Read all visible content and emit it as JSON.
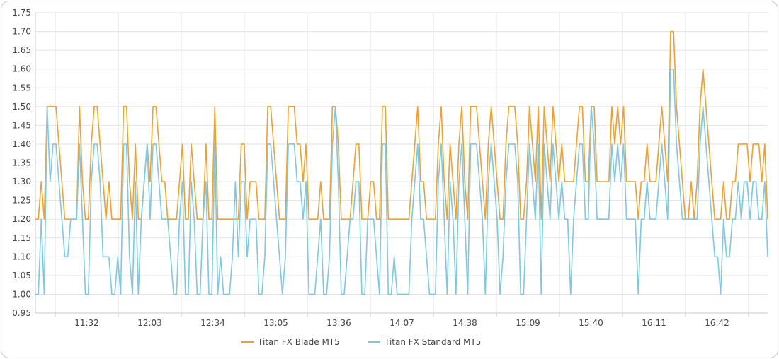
{
  "colors": {
    "blade": "#f0a030",
    "standard": "#7ec8e3",
    "grid": "#e3e3e3",
    "axis": "#c8c8c8"
  },
  "chart_data": {
    "type": "line",
    "title": "",
    "xlabel": "",
    "ylabel": "",
    "ylim": [
      0.95,
      1.75
    ],
    "yticks": [
      "0.95",
      "1.00",
      "1.05",
      "1.10",
      "1.15",
      "1.20",
      "1.25",
      "1.30",
      "1.35",
      "1.40",
      "1.45",
      "1.50",
      "1.55",
      "1.60",
      "1.65",
      "1.70",
      "1.75"
    ],
    "xticks": [
      "11:32",
      "12:03",
      "12:34",
      "13:05",
      "13:36",
      "14:07",
      "14:38",
      "15:09",
      "15:40",
      "16:11",
      "16:42"
    ],
    "legend_position": "bottom",
    "x_points": 230,
    "series": [
      {
        "name": "Titan FX Blade MT5",
        "color": "#f0a030",
        "values": [
          1.2,
          1.2,
          1.3,
          1.2,
          1.5,
          1.5,
          1.5,
          1.5,
          1.4,
          1.3,
          1.2,
          1.2,
          1.2,
          1.2,
          1.2,
          1.5,
          1.3,
          1.2,
          1.2,
          1.4,
          1.5,
          1.5,
          1.4,
          1.3,
          1.2,
          1.3,
          1.2,
          1.2,
          1.2,
          1.2,
          1.5,
          1.5,
          1.3,
          1.2,
          1.4,
          1.2,
          1.2,
          1.3,
          1.4,
          1.3,
          1.5,
          1.5,
          1.4,
          1.3,
          1.3,
          1.2,
          1.2,
          1.2,
          1.2,
          1.3,
          1.4,
          1.2,
          1.2,
          1.4,
          1.3,
          1.2,
          1.2,
          1.2,
          1.4,
          1.2,
          1.2,
          1.5,
          1.2,
          1.2,
          1.2,
          1.2,
          1.2,
          1.2,
          1.2,
          1.2,
          1.4,
          1.4,
          1.2,
          1.3,
          1.3,
          1.3,
          1.2,
          1.2,
          1.2,
          1.5,
          1.5,
          1.4,
          1.3,
          1.2,
          1.2,
          1.2,
          1.5,
          1.5,
          1.5,
          1.4,
          1.4,
          1.3,
          1.4,
          1.2,
          1.2,
          1.2,
          1.2,
          1.3,
          1.2,
          1.2,
          1.2,
          1.5,
          1.5,
          1.4,
          1.2,
          1.2,
          1.2,
          1.2,
          1.3,
          1.4,
          1.4,
          1.2,
          1.2,
          1.2,
          1.3,
          1.3,
          1.2,
          1.2,
          1.5,
          1.5,
          1.2,
          1.2,
          1.2,
          1.2,
          1.2,
          1.2,
          1.2,
          1.2,
          1.3,
          1.4,
          1.5,
          1.3,
          1.3,
          1.2,
          1.2,
          1.2,
          1.2,
          1.4,
          1.5,
          1.3,
          1.2,
          1.4,
          1.3,
          1.2,
          1.4,
          1.5,
          1.3,
          1.2,
          1.5,
          1.5,
          1.5,
          1.4,
          1.3,
          1.2,
          1.4,
          1.5,
          1.4,
          1.3,
          1.2,
          1.2,
          1.4,
          1.5,
          1.5,
          1.5,
          1.4,
          1.2,
          1.2,
          1.3,
          1.5,
          1.4,
          1.3,
          1.5,
          1.2,
          1.5,
          1.4,
          1.3,
          1.5,
          1.4,
          1.3,
          1.4,
          1.3,
          1.3,
          1.3,
          1.3,
          1.4,
          1.5,
          1.5,
          1.3,
          1.3,
          1.5,
          1.5,
          1.3,
          1.3,
          1.3,
          1.3,
          1.3,
          1.5,
          1.4,
          1.5,
          1.4,
          1.5,
          1.3,
          1.3,
          1.3,
          1.3,
          1.2,
          1.3,
          1.3,
          1.4,
          1.3,
          1.3,
          1.3,
          1.4,
          1.5,
          1.4,
          1.3,
          1.7,
          1.7,
          1.5,
          1.4,
          1.3,
          1.2,
          1.2,
          1.3,
          1.2,
          1.3,
          1.5,
          1.6,
          1.5,
          1.4,
          1.3,
          1.2,
          1.2,
          1.2,
          1.3,
          1.2,
          1.2,
          1.3,
          1.3,
          1.4,
          1.4,
          1.4,
          1.4,
          1.3,
          1.4,
          1.4,
          1.4,
          1.3,
          1.4,
          1.2
        ]
      },
      {
        "name": "Titan FX Standard MT5",
        "color": "#7ec8e3",
        "values": [
          1.0,
          1.0,
          1.2,
          1.0,
          1.5,
          1.3,
          1.4,
          1.4,
          1.3,
          1.2,
          1.1,
          1.1,
          1.2,
          1.2,
          1.2,
          1.4,
          1.2,
          1.0,
          1.0,
          1.3,
          1.4,
          1.4,
          1.3,
          1.1,
          1.1,
          1.1,
          1.0,
          1.0,
          1.1,
          1.0,
          1.4,
          1.4,
          1.1,
          1.0,
          1.3,
          1.0,
          1.2,
          1.3,
          1.4,
          1.2,
          1.4,
          1.4,
          1.3,
          1.2,
          1.2,
          1.2,
          1.1,
          1.0,
          1.0,
          1.2,
          1.3,
          1.0,
          1.0,
          1.3,
          1.2,
          1.0,
          1.0,
          1.2,
          1.3,
          1.0,
          1.0,
          1.4,
          1.0,
          1.1,
          1.0,
          1.0,
          1.0,
          1.1,
          1.3,
          1.1,
          1.3,
          1.3,
          1.1,
          1.2,
          1.2,
          1.2,
          1.0,
          1.0,
          1.1,
          1.4,
          1.4,
          1.3,
          1.2,
          1.1,
          1.0,
          1.1,
          1.4,
          1.4,
          1.4,
          1.3,
          1.3,
          1.2,
          1.3,
          1.0,
          1.0,
          1.0,
          1.1,
          1.2,
          1.0,
          1.0,
          1.1,
          1.4,
          1.5,
          1.3,
          1.0,
          1.0,
          1.1,
          1.2,
          1.2,
          1.3,
          1.3,
          1.0,
          1.0,
          1.2,
          1.2,
          1.2,
          1.1,
          1.0,
          1.4,
          1.4,
          1.0,
          1.0,
          1.1,
          1.0,
          1.0,
          1.0,
          1.0,
          1.0,
          1.2,
          1.3,
          1.4,
          1.2,
          1.2,
          1.1,
          1.0,
          1.0,
          1.0,
          1.3,
          1.4,
          1.2,
          1.0,
          1.3,
          1.2,
          1.0,
          1.3,
          1.4,
          1.2,
          1.0,
          1.4,
          1.4,
          1.4,
          1.3,
          1.2,
          1.0,
          1.3,
          1.4,
          1.3,
          1.2,
          1.0,
          1.1,
          1.3,
          1.4,
          1.4,
          1.4,
          1.3,
          1.0,
          1.0,
          1.2,
          1.4,
          1.3,
          1.2,
          1.4,
          1.0,
          1.4,
          1.3,
          1.2,
          1.4,
          1.3,
          1.2,
          1.3,
          1.2,
          1.2,
          1.0,
          1.2,
          1.3,
          1.4,
          1.4,
          1.2,
          1.2,
          1.5,
          1.4,
          1.2,
          1.2,
          1.2,
          1.2,
          1.2,
          1.4,
          1.3,
          1.4,
          1.3,
          1.4,
          1.2,
          1.2,
          1.2,
          1.2,
          1.0,
          1.2,
          1.2,
          1.3,
          1.2,
          1.2,
          1.2,
          1.3,
          1.4,
          1.3,
          1.2,
          1.6,
          1.6,
          1.4,
          1.3,
          1.2,
          1.2,
          1.2,
          1.2,
          1.2,
          1.2,
          1.4,
          1.5,
          1.4,
          1.3,
          1.2,
          1.1,
          1.1,
          1.0,
          1.2,
          1.1,
          1.1,
          1.2,
          1.2,
          1.3,
          1.2,
          1.3,
          1.3,
          1.2,
          1.3,
          1.3,
          1.2,
          1.2,
          1.3,
          1.1
        ]
      }
    ]
  }
}
